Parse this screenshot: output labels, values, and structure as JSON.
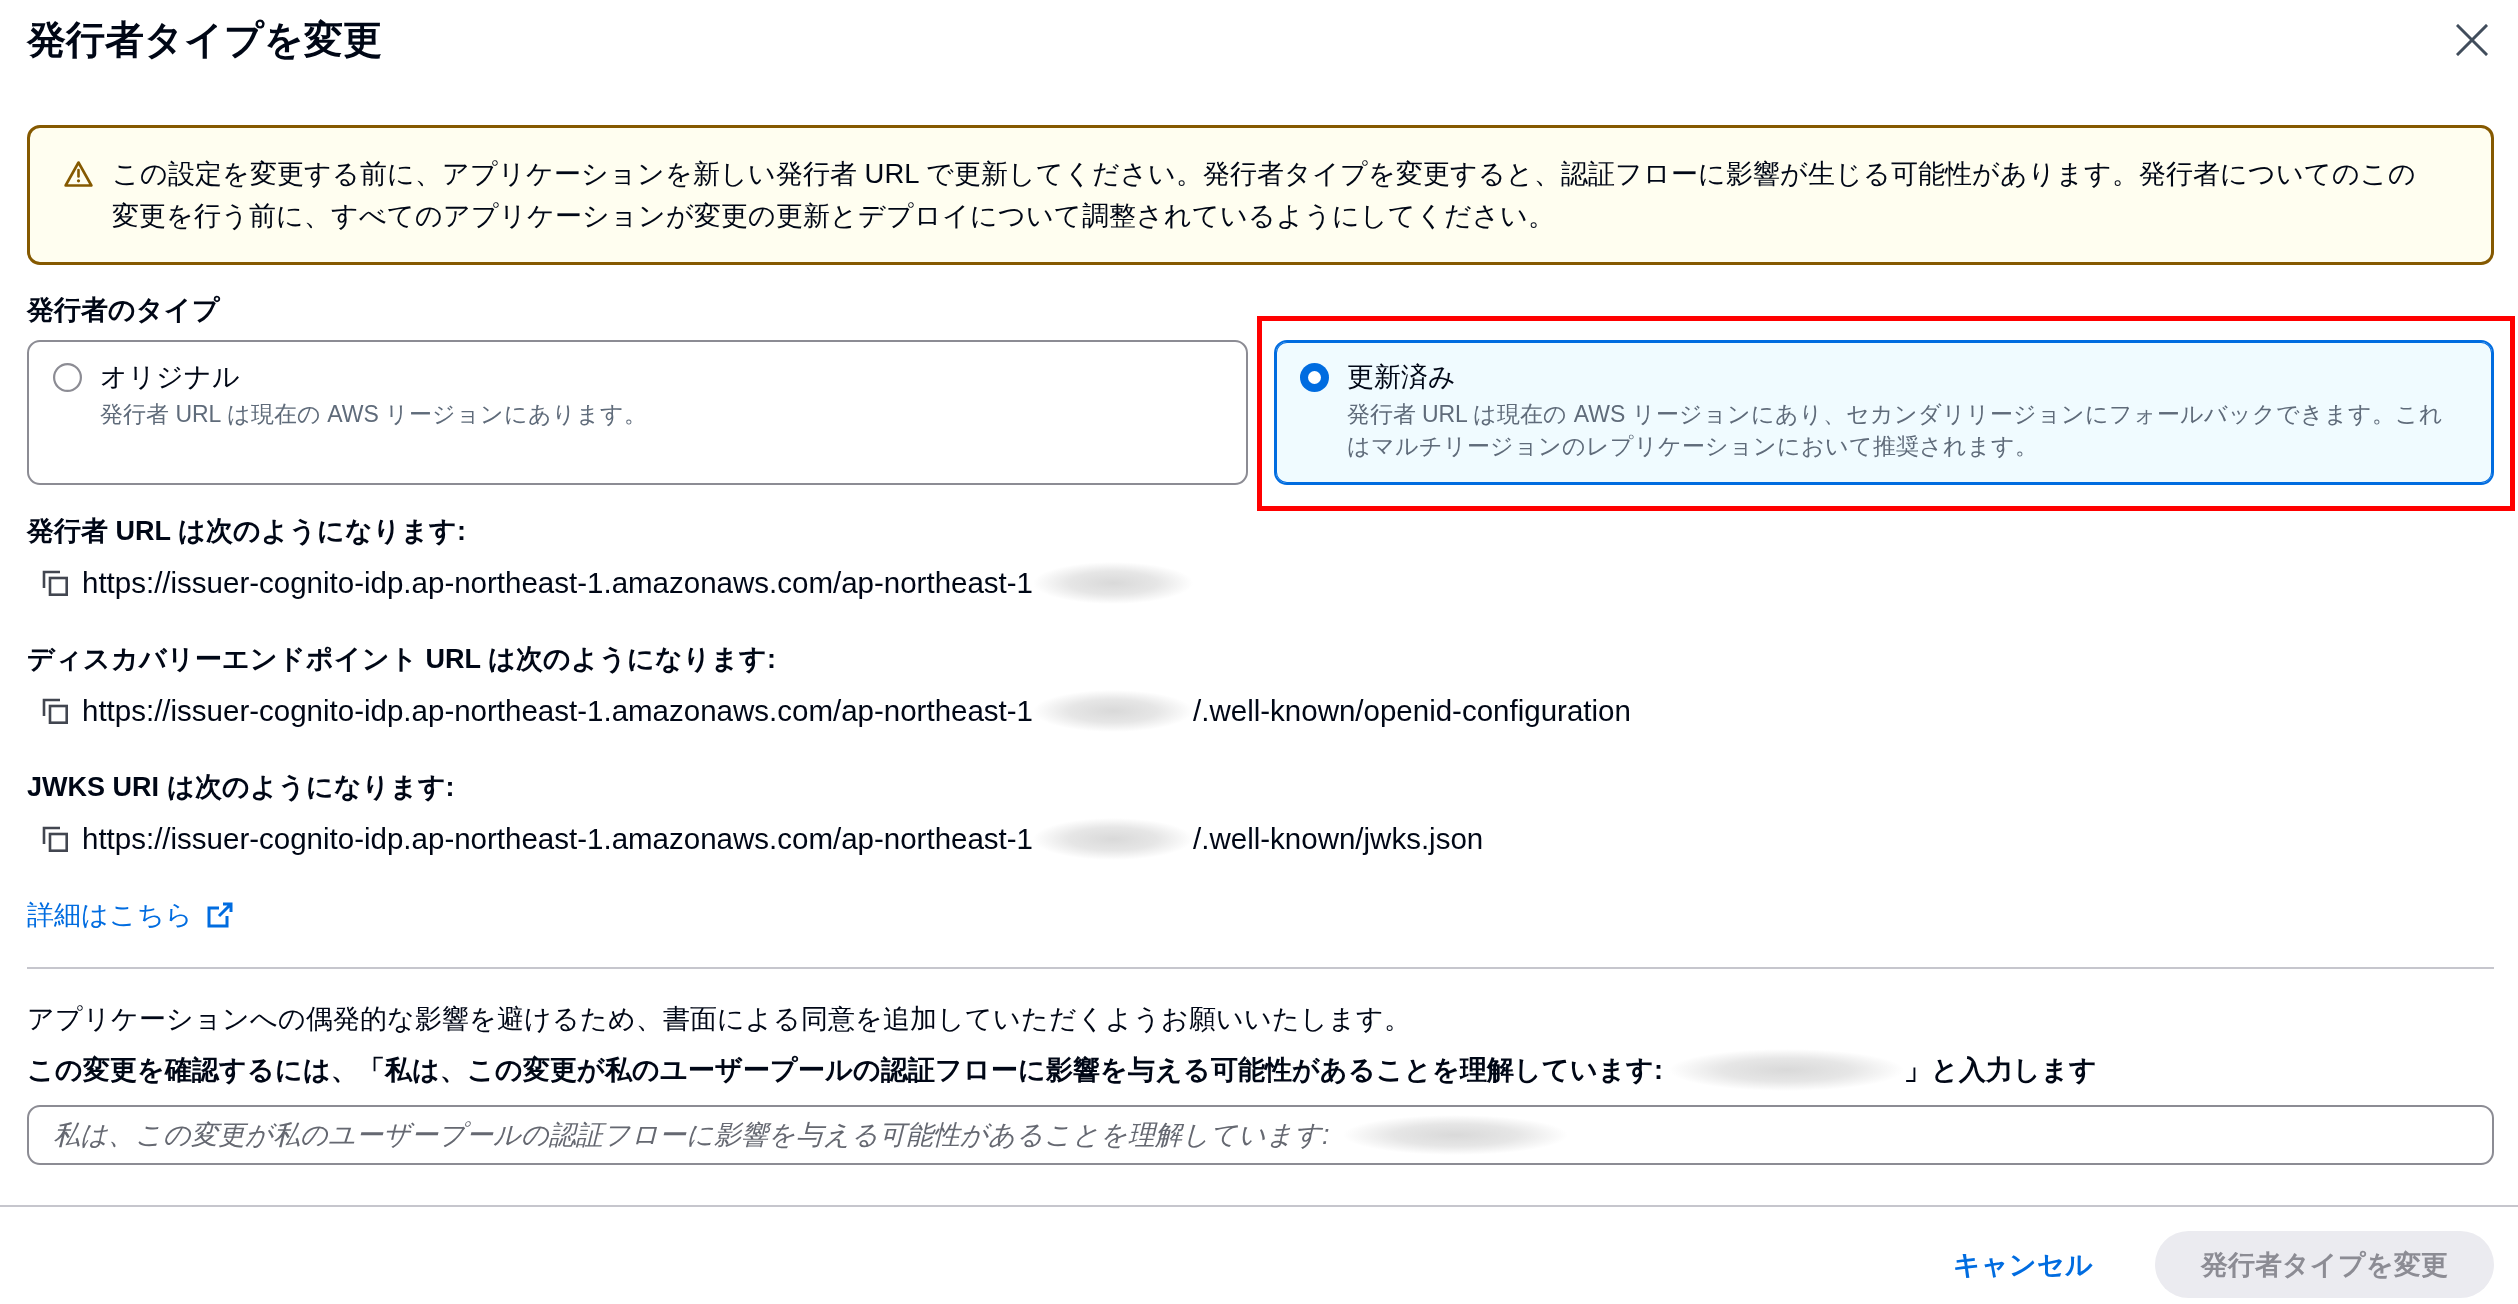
{
  "dialog": {
    "title": "発行者タイプを変更"
  },
  "warning": {
    "text": "この設定を変更する前に、アプリケーションを新しい発行者 URL で更新してください。発行者タイプを変更すると、認証フローに影響が生じる可能性があります。発行者についてのこの変更を行う前に、すべてのアプリケーションが変更の更新とデプロイについて調整されているようにしてください。"
  },
  "issuer_type": {
    "label": "発行者のタイプ",
    "options": [
      {
        "label": "オリジナル",
        "description": "発行者 URL は現在の AWS リージョンにあります。",
        "selected": false,
        "highlighted": false
      },
      {
        "label": "更新済み",
        "description": "発行者 URL は現在の AWS リージョンにあり、セカンダリリージョンにフォールバックできます。これはマルチリージョンのレプリケーションにおいて推奨されます。",
        "selected": true,
        "highlighted": true
      }
    ]
  },
  "endpoints": [
    {
      "label": "発行者 URL は次のようになります:",
      "prefix": "https://issuer-cognito-idp.ap-northeast-1.amazonaws.com/ap-northeast-1",
      "redacted": true
    },
    {
      "label": "ディスカバリーエンドポイント URL は次のようになります:",
      "prefix": "https://issuer-cognito-idp.ap-northeast-1.amazonaws.com/ap-northeast-1",
      "redacted": true,
      "suffix": "/.well-known/openid-configuration"
    },
    {
      "label": "JWKS URI は次のようになります:",
      "prefix": "https://issuer-cognito-idp.ap-northeast-1.amazonaws.com/ap-northeast-1",
      "redacted": true,
      "suffix": "/.well-known/jwks.json"
    }
  ],
  "learn_more": {
    "text": "詳細はこちら",
    "external": true
  },
  "confirmation": {
    "description": "アプリケーションへの偶発的な影響を避けるため、書面による同意を追加していただくようお願いいたします。",
    "instruction_before": "この変更を確認するには、「私は、この変更が私のユーザープールの認証フローに影響を与える可能性があることを理解しています:",
    "redacted": true,
    "instruction_after": "」と入力します",
    "input": {
      "placeholder": "私は、この変更が私のユーザープールの認証フローに影響を与える可能性があることを理解しています:",
      "redacted": true
    }
  },
  "footer": {
    "buttons": [
      {
        "label": "キャンセル",
        "kind": "link",
        "disabled": false
      },
      {
        "label": "発行者タイプを変更",
        "kind": "primary",
        "disabled": true
      }
    ]
  }
}
